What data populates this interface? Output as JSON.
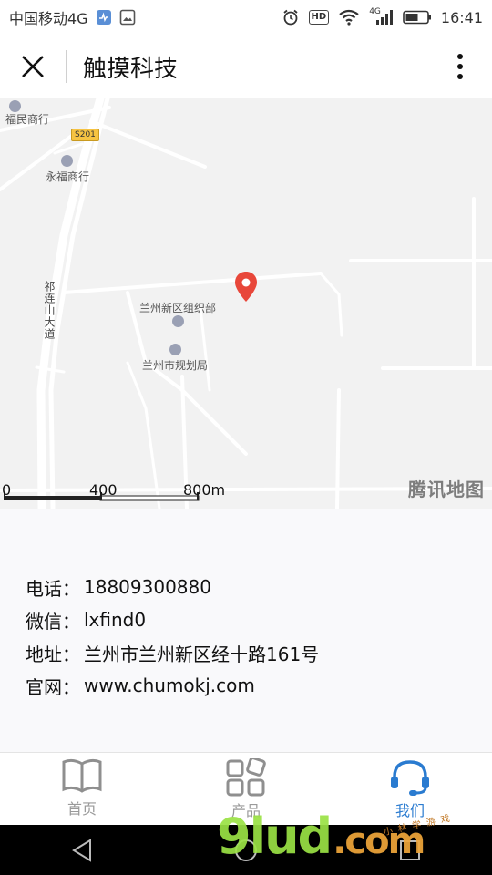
{
  "status_bar": {
    "carrier": "中国移动4G",
    "network_small": "4G",
    "hd_badge": "HD",
    "time": "16:41"
  },
  "header": {
    "title": "触摸科技",
    "close_icon": "close-icon",
    "menu_icon": "more-vertical-icon"
  },
  "map": {
    "labels": {
      "place_1": "福民商行",
      "place_2": "永福商行",
      "road_badge": "S201",
      "place_3": "兰州新区组织部",
      "place_4": "兰州市规划局",
      "road_vertical": "祁连山大道"
    },
    "scale": {
      "tick_0": "0",
      "tick_1": "400",
      "tick_2": "800m"
    },
    "logo": "腾讯地图",
    "marker_color": "#e8473a"
  },
  "contact": {
    "phone_label": "电话：",
    "phone": "18809300880",
    "wechat_label": "微信：",
    "wechat": "lxfind0",
    "address_label": "地址：",
    "address": "兰州市兰州新区经十路161号",
    "website_label": "官网：",
    "website": "www.chumokj.com"
  },
  "tabs": [
    {
      "label": "首页",
      "icon": "book-icon",
      "active": false
    },
    {
      "label": "产品",
      "icon": "grid-icon",
      "active": false
    },
    {
      "label": "我们",
      "icon": "headset-icon",
      "active": true
    }
  ],
  "watermark": {
    "main": "9lud",
    "suffix": ".com",
    "small": "小林学游戏"
  },
  "colors": {
    "accent": "#2a7bd0",
    "inactive": "#9a9a9a"
  }
}
